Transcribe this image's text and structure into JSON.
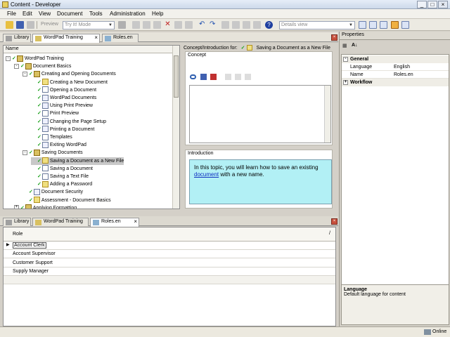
{
  "window": {
    "title": "Content - Developer",
    "minimize": "_",
    "maximize": "□",
    "close": "×"
  },
  "menu": [
    "File",
    "Edit",
    "View",
    "Document",
    "Tools",
    "Administration",
    "Help"
  ],
  "toolbar": {
    "preview_label": "Preview",
    "mode_value": "Try It! Mode",
    "view_value": "Details view"
  },
  "top_tabs": [
    {
      "label": "Library"
    },
    {
      "label": "WordPad Training"
    },
    {
      "label": "Roles.en"
    }
  ],
  "tree": {
    "column": "Name",
    "nodes": [
      {
        "label": "WordPad Training",
        "level": 0,
        "toggle": "-",
        "check": true,
        "icon": "book"
      },
      {
        "label": "Document Basics",
        "level": 1,
        "toggle": "-",
        "check": true,
        "icon": "book"
      },
      {
        "label": "Creating and Opening Documents",
        "level": 2,
        "toggle": "-",
        "check": true,
        "icon": "book"
      },
      {
        "label": "Creating a New Document",
        "level": 3,
        "check": true,
        "icon": "flag"
      },
      {
        "label": "Opening a Document",
        "level": 3,
        "check": true,
        "icon": "doc"
      },
      {
        "label": "WordPad Documents",
        "level": 3,
        "check": true,
        "icon": "pg"
      },
      {
        "label": "Using Print Preview",
        "level": 3,
        "check": true,
        "icon": "pg"
      },
      {
        "label": "Print Preview",
        "level": 3,
        "check": true,
        "icon": "doc"
      },
      {
        "label": "Changing the Page Setup",
        "level": 3,
        "check": true,
        "icon": "pg"
      },
      {
        "label": "Printing a Document",
        "level": 3,
        "check": true,
        "icon": "pg"
      },
      {
        "label": "Templates",
        "level": 3,
        "check": true,
        "icon": "doc"
      },
      {
        "label": "Exiting WordPad",
        "level": 3,
        "check": true,
        "icon": "pg"
      },
      {
        "label": "Saving Documents",
        "level": 2,
        "toggle": "-",
        "check": true,
        "icon": "book"
      },
      {
        "label": "Saving a Document as a New File",
        "level": 3,
        "check": true,
        "icon": "flag",
        "selected": true
      },
      {
        "label": "Saving a Document",
        "level": 3,
        "check": true,
        "icon": "doc"
      },
      {
        "label": "Saving a Text File",
        "level": 3,
        "check": true,
        "icon": "doc"
      },
      {
        "label": "Adding a Password",
        "level": 3,
        "check": true,
        "icon": "flag"
      },
      {
        "label": "Document Security",
        "level": 2,
        "check": true,
        "icon": "pg"
      },
      {
        "label": "Assessment - Document Basics",
        "level": 2,
        "check": true,
        "icon": "flag"
      },
      {
        "label": "Applying Formatting",
        "level": 1,
        "toggle": "+",
        "check": true,
        "icon": "book"
      }
    ]
  },
  "concept": {
    "header_prefix": "Concept/Introduction for:",
    "header_title": "Saving a Document as a New File",
    "concept_caption": "Concept",
    "intro_caption": "Introduction",
    "intro_text_before": "In this topic, you will learn how to save an existing ",
    "intro_link": "document",
    "intro_text_after": " with a new name."
  },
  "bottom_tabs": [
    {
      "label": "Library"
    },
    {
      "label": "WordPad Training"
    },
    {
      "label": "Roles.en"
    }
  ],
  "roles": {
    "column": "Role",
    "sort_glyph": "/",
    "rows": [
      "Account Clerk",
      "Account Supervisor",
      "Customer Support",
      "Supply Manager"
    ]
  },
  "properties": {
    "title": "Properties",
    "categories": [
      {
        "name": "General",
        "toggle": "-",
        "rows": [
          {
            "key": "Language",
            "value": "English"
          },
          {
            "key": "Name",
            "value": "Roles.en"
          }
        ]
      },
      {
        "name": "Workflow",
        "toggle": "+",
        "rows": []
      }
    ],
    "desc_title": "Language",
    "desc_text": "Default language for content"
  },
  "status": {
    "online": "Online"
  }
}
